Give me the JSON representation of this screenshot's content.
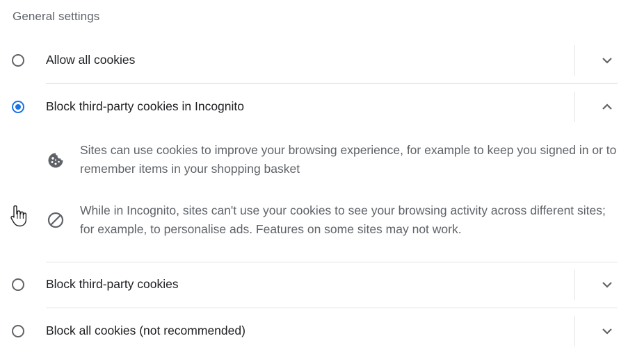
{
  "section": {
    "title": "General settings"
  },
  "options": [
    {
      "label": "Allow all cookies",
      "selected": false,
      "expanded": false
    },
    {
      "label": "Block third-party cookies in Incognito",
      "selected": true,
      "expanded": true
    },
    {
      "label": "Block third-party cookies",
      "selected": false,
      "expanded": false
    },
    {
      "label": "Block all cookies (not recommended)",
      "selected": false,
      "expanded": false
    }
  ],
  "details": [
    {
      "icon": "cookie-icon",
      "text": "Sites can use cookies to improve your browsing experience, for example to keep you signed in or to remember items in your shopping basket"
    },
    {
      "icon": "block-icon",
      "text": "While in Incognito, sites can't use your cookies to see your browsing activity across different sites; for example, to personalise ads. Features on some sites may not work."
    }
  ],
  "colors": {
    "accent": "#1a73e8",
    "icon": "#5f6368",
    "text": "#202124",
    "secondary_text": "#5f6368",
    "divider": "#e3e3e3"
  }
}
